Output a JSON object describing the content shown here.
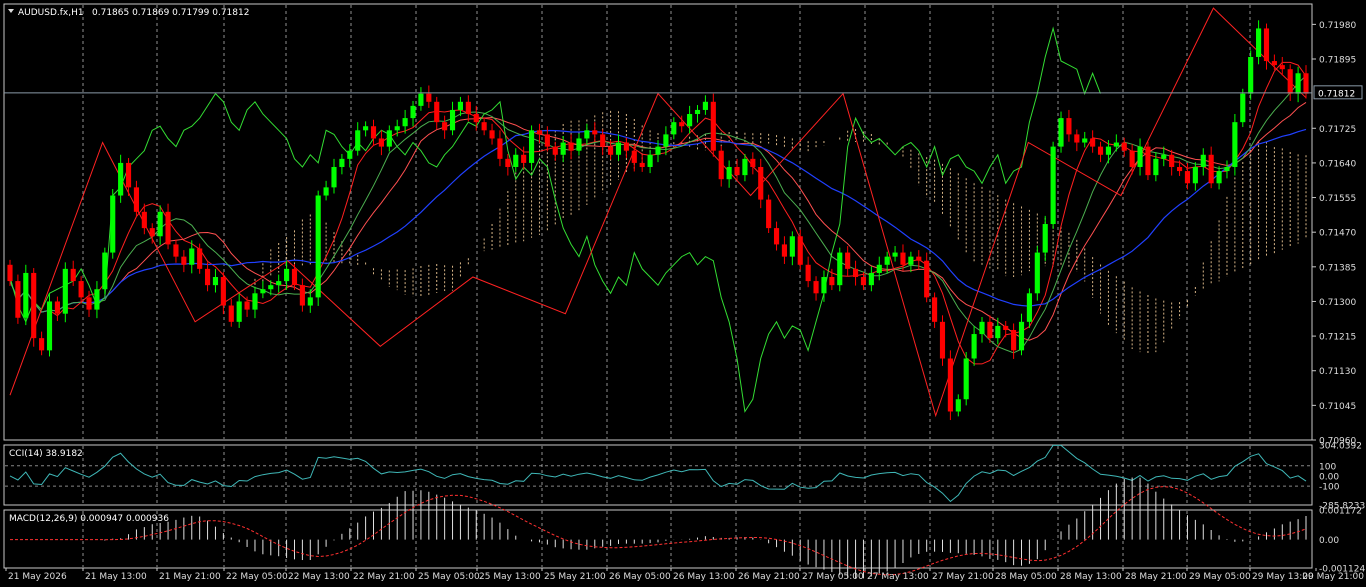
{
  "main_panel": {
    "symbol_line": "AUDUSD.fx,H1",
    "ohlc_line": "0.71865 0.71869 0.71799 0.71812",
    "price_ticks": [
      "0.71980",
      "0.71895",
      "0.71725",
      "0.71640",
      "0.71555",
      "0.71470",
      "0.71385",
      "0.71300",
      "0.71215",
      "0.71130",
      "0.71045",
      "0.70960"
    ],
    "current_price_label": "0.71812"
  },
  "time_labels": [
    "21 May 2026",
    "21 May 13:00",
    "21 May 21:00",
    "22 May 05:00",
    "22 May 13:00",
    "22 May 21:00",
    "25 May 05:00",
    "25 May 13:00",
    "25 May 21:00",
    "26 May 05:00",
    "26 May 13:00",
    "26 May 21:00",
    "27 May 05:00",
    "27 May 13:00",
    "27 May 21:00",
    "28 May 05:00",
    "28 May 13:00",
    "28 May 21:00",
    "29 May 05:00",
    "29 May 13:00",
    "29 May 21:00"
  ],
  "cci_panel": {
    "label": "CCI(14) 38.9182",
    "ticks": [
      "304.0392",
      "100",
      "0.00",
      "-100",
      "-285.8233"
    ]
  },
  "macd_panel": {
    "label": "MACD(12,26,9) 0.000947 0.000936",
    "ticks": [
      "0.001172",
      "0.00",
      "-0.001124"
    ]
  },
  "colors": {
    "background": "#000000",
    "frame": "#c8c8c8",
    "grid": "#bfbfbf",
    "bull": "#00ff00",
    "bear": "#ff0000",
    "zigzag": "#ff2222",
    "ma_fast": "#ff2020",
    "ma_slow": "#2040ff",
    "chikou": "#33dd33",
    "cloud": "#ffd7a0",
    "cci": "#3fb7b7",
    "macd_signal": "#ff3030",
    "macd_hist": "#e0e0e0"
  },
  "chart_data": [
    {
      "type": "candlestick",
      "title": "AUDUSD.fx,H1",
      "ylim": [
        0.7096,
        0.7203
      ],
      "last_close": 0.71812,
      "closes": [
        0.7135,
        0.7126,
        0.7137,
        0.7121,
        0.7118,
        0.713,
        0.7127,
        0.7138,
        0.7135,
        0.7131,
        0.7128,
        0.7133,
        0.7142,
        0.7156,
        0.7164,
        0.7158,
        0.7152,
        0.7148,
        0.7146,
        0.7152,
        0.7144,
        0.7141,
        0.7139,
        0.7143,
        0.7138,
        0.7134,
        0.7136,
        0.7129,
        0.7125,
        0.713,
        0.7128,
        0.7132,
        0.7133,
        0.7134,
        0.7135,
        0.7138,
        0.7134,
        0.7129,
        0.7131,
        0.7156,
        0.7158,
        0.7163,
        0.7165,
        0.7167,
        0.7172,
        0.7173,
        0.717,
        0.7168,
        0.7172,
        0.7173,
        0.7175,
        0.7178,
        0.7181,
        0.7179,
        0.7174,
        0.7172,
        0.7177,
        0.7179,
        0.7176,
        0.7174,
        0.7172,
        0.717,
        0.7165,
        0.7163,
        0.7166,
        0.7164,
        0.7172,
        0.7171,
        0.7168,
        0.7166,
        0.7169,
        0.7167,
        0.717,
        0.7172,
        0.7171,
        0.7168,
        0.7166,
        0.7169,
        0.7167,
        0.7164,
        0.7163,
        0.7166,
        0.7168,
        0.7171,
        0.7174,
        0.7173,
        0.7176,
        0.7177,
        0.7179,
        0.7167,
        0.716,
        0.7163,
        0.7161,
        0.7165,
        0.7163,
        0.7155,
        0.7148,
        0.7144,
        0.7141,
        0.7146,
        0.7139,
        0.7135,
        0.7132,
        0.7136,
        0.7134,
        0.7142,
        0.7138,
        0.7136,
        0.7134,
        0.7137,
        0.7139,
        0.7141,
        0.7142,
        0.7139,
        0.7141,
        0.714,
        0.7131,
        0.7125,
        0.7116,
        0.7103,
        0.7106,
        0.7116,
        0.7122,
        0.7125,
        0.7121,
        0.7124,
        0.7123,
        0.7118,
        0.7125,
        0.7132,
        0.7142,
        0.7149,
        0.7168,
        0.7175,
        0.7171,
        0.7169,
        0.717,
        0.7168,
        0.7166,
        0.7168,
        0.7169,
        0.7167,
        0.7163,
        0.7168,
        0.7161,
        0.7165,
        0.7166,
        0.7163,
        0.7162,
        0.7159,
        0.7163,
        0.7166,
        0.7159,
        0.7162,
        0.7163,
        0.7174,
        0.7181,
        0.719,
        0.7197,
        0.7189,
        0.7188,
        0.7187,
        0.7181,
        0.7186,
        0.7181
      ],
      "zigzag_points": [
        0.7107,
        0.7169,
        0.7125,
        0.714,
        0.7119,
        0.7136,
        0.7127,
        0.7181,
        0.7156,
        0.7181,
        0.7102,
        0.7169,
        0.7156,
        0.7202,
        0.718
      ],
      "cci": {
        "name": "CCI(14)",
        "last": 38.9182,
        "ylim": [
          -285.8233,
          304.0392
        ],
        "levels": [
          100,
          0,
          -100
        ]
      },
      "macd": {
        "name": "MACD(12,26,9)",
        "main": 0.000947,
        "signal": 0.000936,
        "ylim": [
          -0.001124,
          0.001172
        ]
      }
    }
  ]
}
